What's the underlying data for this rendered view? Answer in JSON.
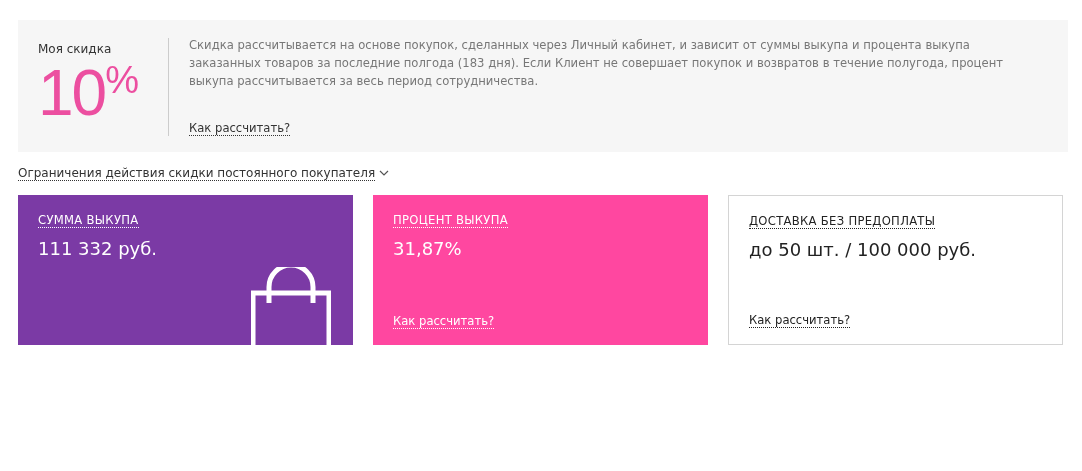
{
  "discount": {
    "label": "Моя скидка",
    "value": "10",
    "unit": "%",
    "description": "Скидка рассчитывается на основе покупок, сделанных через Личный кабинет, и зависит от суммы выкупа и процента выкупа заказанных товаров за последние полгода (183 дня). Если Клиент не совершает покупок и возвратов в течение полугода, процент выкупа рассчитывается за весь период сотрудничества.",
    "link": "Как рассчитать?"
  },
  "restrictions": {
    "label": "Ограничения действия скидки постоянного покупателя",
    "expanded": false
  },
  "cards": [
    {
      "kind": "amount",
      "title": "СУММА ВЫКУПА",
      "value": "111 332 руб."
    },
    {
      "kind": "percent",
      "title": "ПРОЦЕНТ ВЫКУПА",
      "value": "31,87%",
      "link": "Как рассчитать?"
    },
    {
      "kind": "delivery",
      "title": "ДОСТАВКА БЕЗ ПРЕДОПЛАТЫ",
      "value": "до 50 шт. / 100 000 руб.",
      "link": "Как рассчитать?"
    }
  ]
}
